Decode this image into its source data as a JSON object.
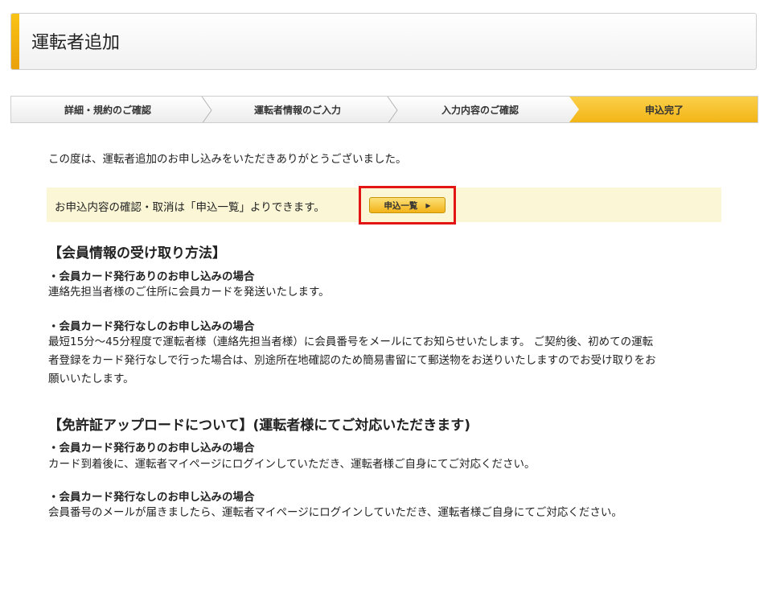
{
  "page": {
    "title": "運転者追加"
  },
  "steps": [
    {
      "label": "詳細・規約のご確認"
    },
    {
      "label": "運転者情報のご入力"
    },
    {
      "label": "入力内容のご確認"
    },
    {
      "label": "申込完了"
    }
  ],
  "intro": "この度は、運転者追加のお申し込みをいただきありがとうございました。",
  "notice": {
    "text": "お申込内容の確認・取消は「申込一覧」よりできます。",
    "button_label": "申込一覧",
    "button_arrow": "▶"
  },
  "section1": {
    "heading": "【会員情報の受け取り方法】",
    "item1_title": "・会員カード発行ありのお申し込みの場合",
    "item1_text": "連絡先担当者様のご住所に会員カードを発送いたします。",
    "item2_title": "・会員カード発行なしのお申し込みの場合",
    "item2_line1": "最短15分〜45分程度で運転者様（連絡先担当者様）に会員番号をメールにてお知らせいたします。 ご契約後、初めての運転",
    "item2_line2": "者登録をカード発行なしで行った場合は、別途所在地確認のため簡易書留にて郵送物をお送りいたしますのでお受け取りをお",
    "item2_line3": "願いいたします。"
  },
  "section2": {
    "heading": "【免許証アップロードについて】(運転者様にてご対応いただきます)",
    "item1_title": "・会員カード発行ありのお申し込みの場合",
    "item1_text": "カード到着後に、運転者マイページにログインしていただき、運転者様ご自身にてご対応ください。",
    "item2_title": "・会員カード発行なしのお申し込みの場合",
    "item2_text": "会員番号のメールが届きましたら、運転者マイページにログインしていただき、運転者様ご自身にてご対応ください。"
  },
  "colors": {
    "accent": "#f2b516",
    "notice_bg": "#faf6d6",
    "highlight": "#e31414"
  }
}
